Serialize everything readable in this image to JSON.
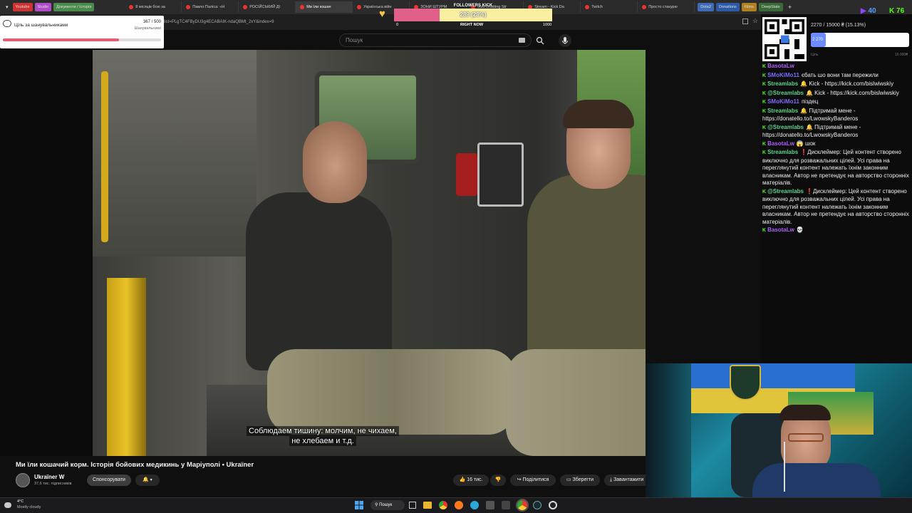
{
  "browser": {
    "bookmarks": [
      {
        "label": "Youtube",
        "color": "#cc3333"
      },
      {
        "label": "Studio",
        "color": "#b04cc8"
      },
      {
        "label": "Документи / Історія",
        "color": "#4a8a4a"
      }
    ],
    "tabs": [
      {
        "label": "8 місяців бою за"
      },
      {
        "label": "Павло Паліса: «Н"
      },
      {
        "label": "РОСІЙСЬКИЙ ДІ"
      },
      {
        "label": "Ми їли кошач",
        "active": true
      },
      {
        "label": "Українська війн"
      },
      {
        "label": "ЗОНИ ШТУРМ"
      },
      {
        "label": "Just Chatting Str"
      },
      {
        "label": "Stream - Kick Da"
      },
      {
        "label": "Twitch"
      },
      {
        "label": "Просто стакурю"
      }
    ],
    "right_bookmarks": [
      {
        "label": "Dota2",
        "color": "#3d6bb8"
      },
      {
        "label": "Donations",
        "color": "#2d5aa8"
      },
      {
        "label": "Films",
        "color": "#b08020"
      },
      {
        "label": "DeepState",
        "color": "#3a6a3a"
      }
    ],
    "address_text": "list=PLgTC4FByDU3g4ECABAIK-ndaQBMt_2xY&index=9",
    "tab_badge": "twitch"
  },
  "youtube": {
    "search_placeholder": "Пошук",
    "video_title": "Ми їли кошачий корм. Історія бойових медикинь у Маріуполі • Ukraїner",
    "channel_name": "Ukraїner W",
    "subscribers": "37,6 тис. підписників",
    "sponsor_label": "Спонсорувати",
    "likes": "16 тис.",
    "share_label": "Поділитися",
    "save_label": "Зберегти",
    "download_label": "Завантажити",
    "subtitle_line1": "Соблюдаем тишину: молчим, не чихаем,",
    "subtitle_line2": "не хлебаем и т.д."
  },
  "goal_overlay": {
    "label": "Ціль за шанувальниками",
    "count": "367 / 500",
    "sublabel": "Шанувальники",
    "progress": 0.734
  },
  "followers_bar": {
    "title": "FOLLOWERS KICK",
    "value": "289 (28%)",
    "progress": 0.289,
    "min": "0",
    "mid": "RIGHT NOW",
    "max": "1000"
  },
  "donation_goal": {
    "label": "2270 / 15000 ₴ (15.13%)",
    "current": "2 270",
    "caption": "Ціль",
    "max": "15 000₴",
    "progress": 0.1513
  },
  "counters": {
    "viewers": "40",
    "kick_viewers": "76"
  },
  "chat": [
    {
      "user": "BasotaLw",
      "color": "#b05cff",
      "text": ""
    },
    {
      "user": "SMoKiMo11",
      "color": "#7a6cff",
      "text": "єбать шо вони там пережили"
    },
    {
      "user": "Streamlabs",
      "color": "#5fd38d",
      "text": "🔔 Kick - https://kick.com/bislwiwskiy"
    },
    {
      "user": "@Streamlabs",
      "color": "#5fd38d",
      "text": "🔔 Kick - https://kick.com/bislwiwskiy"
    },
    {
      "user": "SMoKiMo11",
      "color": "#7a6cff",
      "text": "піздец"
    },
    {
      "user": "Streamlabs",
      "color": "#5fd38d",
      "text": "🔔 Підтримай мене - https://donatello.to/LwowskyBanderos"
    },
    {
      "user": "@Streamlabs",
      "color": "#5fd38d",
      "text": "🔔 Підтримай мене - https://donatello.to/LwowskyBanderos"
    },
    {
      "user": "BasotaLw",
      "color": "#b05cff",
      "text": "😱 шок"
    },
    {
      "user": "Streamlabs",
      "color": "#5fd38d",
      "text": "❗Дисклеймер: Цей контент створено виключно для розважальних цілей. Усі права на переглянутий контент належать їхнім законним власникам. Автор не претендує на авторство сторонніх матеріалів."
    },
    {
      "user": "@Streamlabs",
      "color": "#5fd38d",
      "text": "❗Дисклеймер: Цей контент створено виключно для розважальних цілей. Усі права на переглянутий контент належать їхнім законним власникам. Автор не претендує на авторство сторонніх матеріалів."
    },
    {
      "user": "BasotaLw",
      "color": "#b05cff",
      "text": "💀"
    }
  ],
  "taskbar": {
    "weather_temp": "4°C",
    "weather_text": "Mostly cloudy",
    "search_label": "Пошук"
  }
}
